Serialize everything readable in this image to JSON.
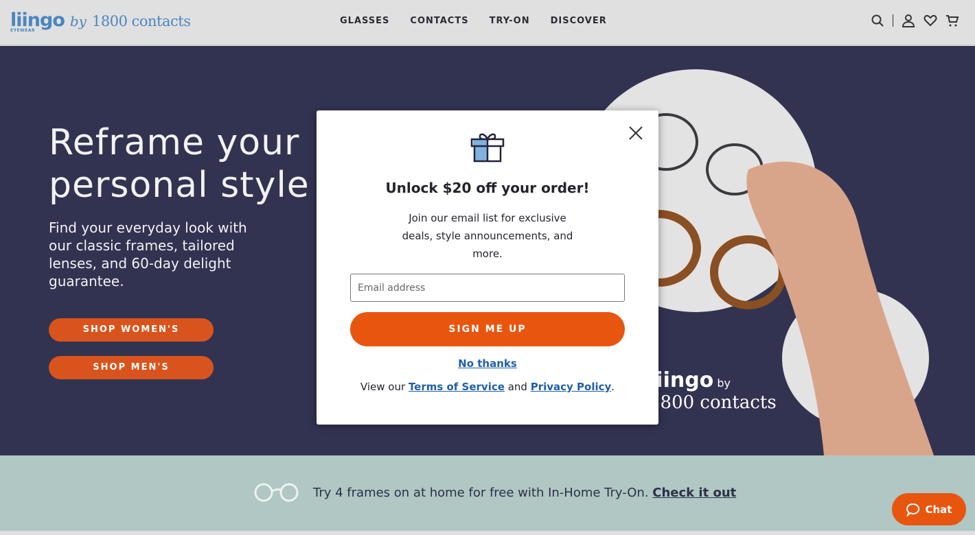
{
  "header": {
    "logo": {
      "name": "liingo",
      "sub": "EYEWEAR",
      "by": "by",
      "partner": "1800 contacts"
    },
    "nav": [
      "GLASSES",
      "CONTACTS",
      "TRY-ON",
      "DISCOVER"
    ],
    "icons": [
      "search-icon",
      "account-icon",
      "heart-icon",
      "cart-icon"
    ]
  },
  "hero": {
    "title": "Reframe your personal style",
    "subtitle": "Find your everyday look with our classic frames, tailored lenses, and 60-day delight guarantee.",
    "buttons": [
      "SHOP WOMEN'S",
      "SHOP MEN'S"
    ],
    "brand": {
      "name": "liingo",
      "by": "by",
      "partner": "1800 contacts"
    }
  },
  "banner": {
    "text": "Try 4 frames on at home for free with In-Home Try-On.",
    "link": "Check it out"
  },
  "chat": {
    "label": "Chat"
  },
  "modal": {
    "title": "Unlock $20 off your order!",
    "description": "Join our email list for exclusive deals, style announcements, and more.",
    "email_placeholder": "Email address",
    "submit": "SIGN ME UP",
    "decline": "No thanks",
    "terms_prefix": "View our",
    "terms_link": "Terms of Service",
    "terms_and": "and",
    "privacy_link": "Privacy Policy",
    "terms_suffix": "."
  },
  "colors": {
    "accent": "#e8550f",
    "hero_bg": "#323351",
    "banner_bg": "#b0c7c4",
    "link": "#1f5fa8",
    "logo": "#4a86c0"
  }
}
